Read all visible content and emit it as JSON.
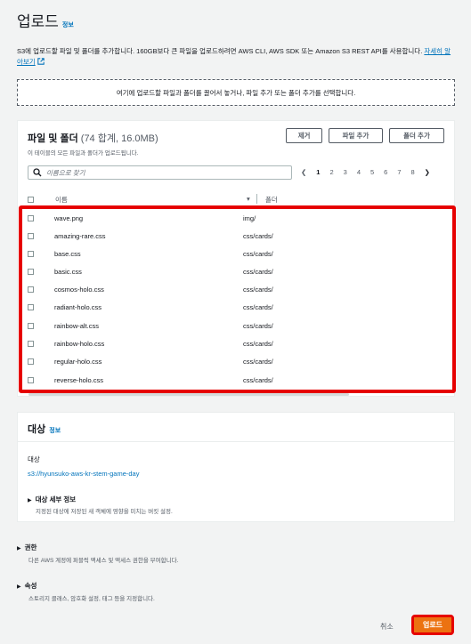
{
  "header": {
    "title": "업로드",
    "info": "정보"
  },
  "description": {
    "text": "S3에 업로드할 파일 및 폴더를 추가합니다. 160GB보다 큰 파일을 업로드하려면 AWS CLI, AWS SDK 또는 Amazon S3 REST API를 사용합니다.",
    "learn_more": "자세히 알아보기"
  },
  "dropzone": {
    "text": "여기에 업로드할 파일과 폴더를 끌어서 놓거나, 파일 추가 또는 폴더 추가를 선택합니다."
  },
  "files_panel": {
    "title": "파일 및 폴더",
    "count": "(74 합계, 16.0MB)",
    "subtitle": "이 테이블의 모든 파일과 폴더가 업로드됩니다.",
    "buttons": {
      "remove": "제거",
      "add_files": "파일 추가",
      "add_folder": "폴더 추가"
    },
    "search_placeholder": "이름으로 찾기",
    "pages": [
      "1",
      "2",
      "3",
      "4",
      "5",
      "6",
      "7",
      "8"
    ],
    "current_page": "1",
    "columns": {
      "name": "이름",
      "folder": "폴더"
    },
    "rows": [
      {
        "name": "wave.png",
        "folder": "img/"
      },
      {
        "name": "amazing-rare.css",
        "folder": "css/cards/"
      },
      {
        "name": "base.css",
        "folder": "css/cards/"
      },
      {
        "name": "basic.css",
        "folder": "css/cards/"
      },
      {
        "name": "cosmos-holo.css",
        "folder": "css/cards/"
      },
      {
        "name": "radiant-holo.css",
        "folder": "css/cards/"
      },
      {
        "name": "rainbow-alt.css",
        "folder": "css/cards/"
      },
      {
        "name": "rainbow-holo.css",
        "folder": "css/cards/"
      },
      {
        "name": "regular-holo.css",
        "folder": "css/cards/"
      },
      {
        "name": "reverse-holo.css",
        "folder": "css/cards/"
      }
    ]
  },
  "destination": {
    "title": "대상",
    "info": "정보",
    "label": "대상",
    "value": "s3://hyunsuko-aws-kr-stem-game-day",
    "details_title": "대상 세부 정보",
    "details_desc": "지정된 대상에 저장된 새 객체에 영향을 미치는 버킷 설정."
  },
  "permissions": {
    "title": "권한",
    "desc": "다른 AWS 계정에 퍼블릭 액세스 및 액세스 권한을 부여합니다."
  },
  "properties": {
    "title": "속성",
    "desc": "스토리지 클래스, 암호화 설정, 태그 등을 지정합니다."
  },
  "footer": {
    "cancel": "취소",
    "upload": "업로드"
  },
  "colors": {
    "accent": "#ec7211",
    "link": "#0073bb",
    "highlight": "#e60000"
  }
}
